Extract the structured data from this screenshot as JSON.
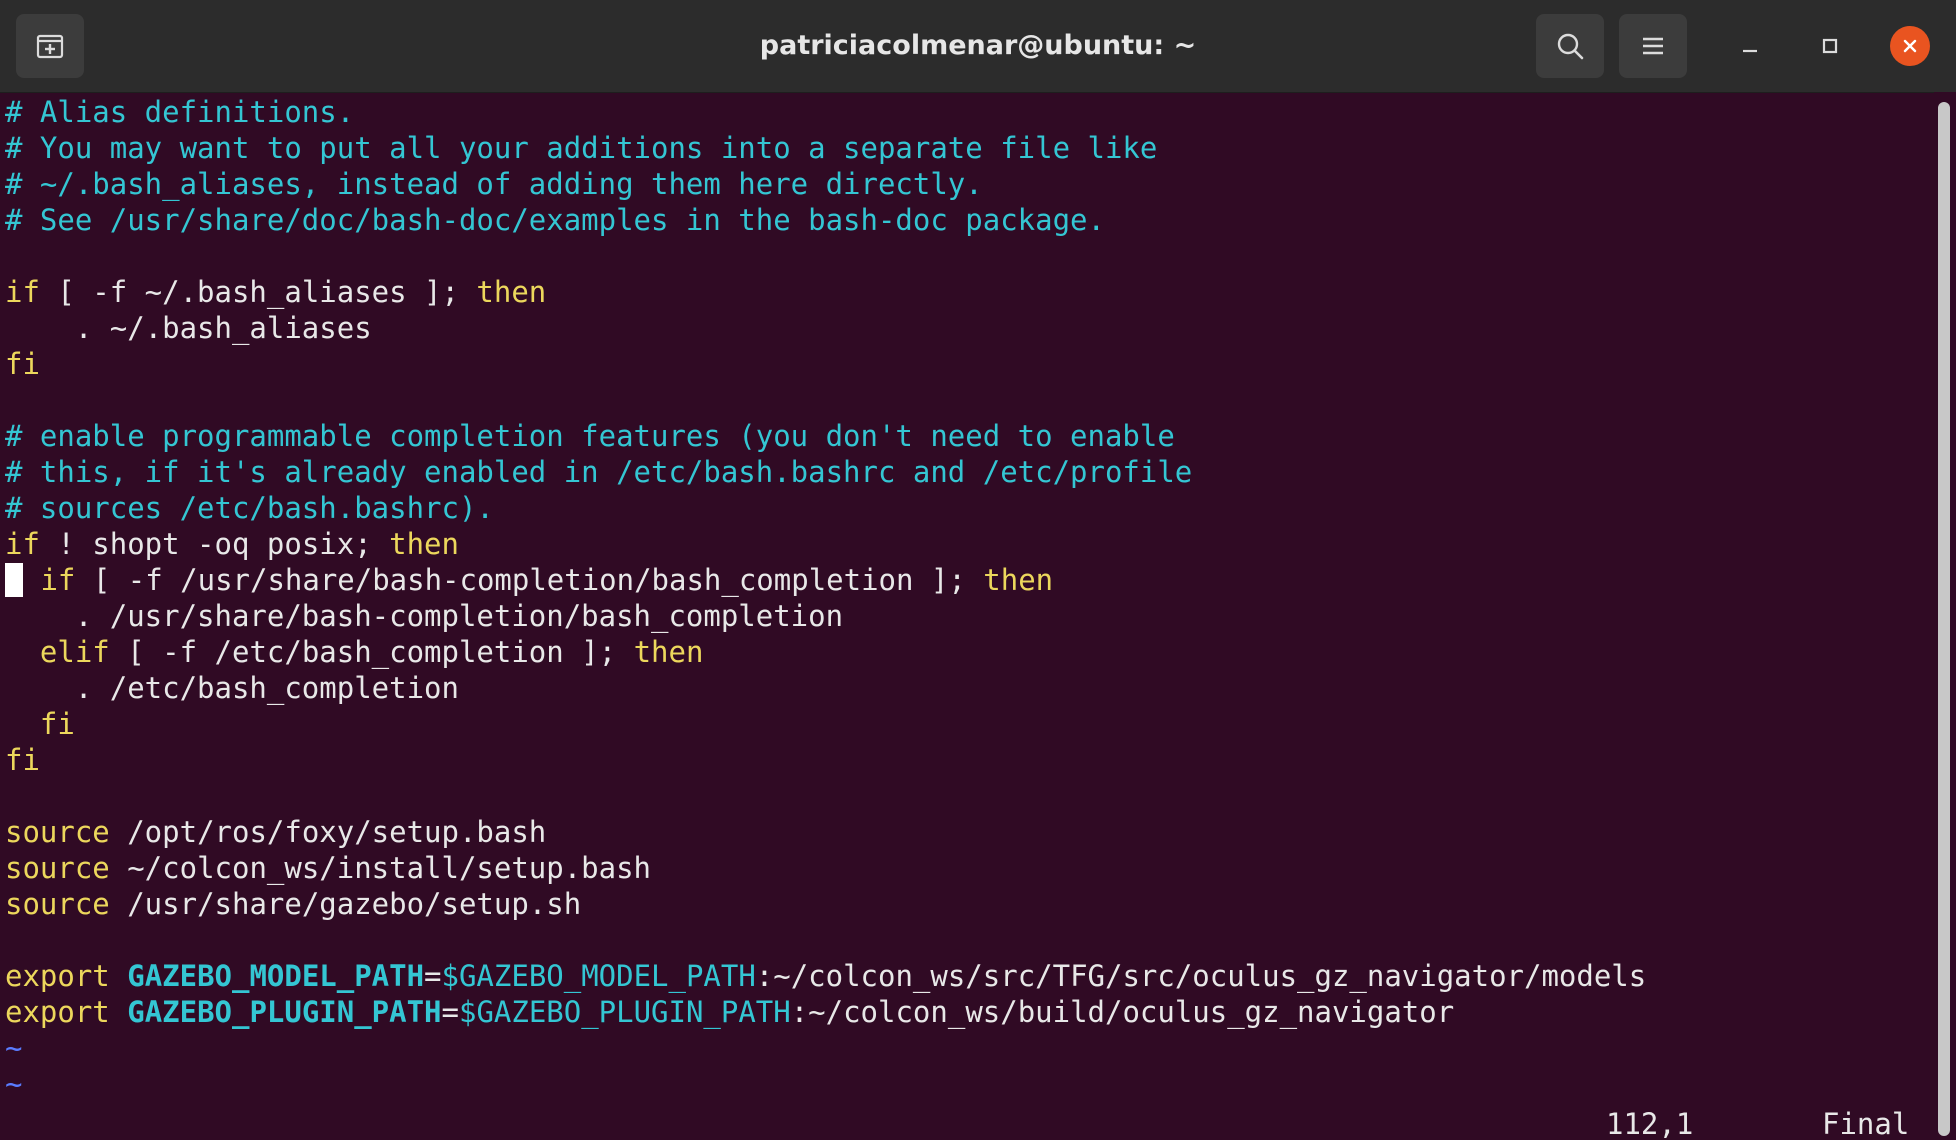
{
  "window": {
    "title": "patriciacolmenar@ubuntu: ~",
    "accent_color": "#e95420",
    "background_color": "#300a24",
    "icons": {
      "new_tab": "new-tab-icon",
      "search": "search-icon",
      "menu": "hamburger-menu-icon",
      "minimize": "minimize-icon",
      "maximize": "maximize-icon",
      "close": "close-icon"
    }
  },
  "editor": {
    "line1": {
      "comment": "# Alias definitions."
    },
    "line2": {
      "comment": "# You may want to put all your additions into a separate file like"
    },
    "line3": {
      "comment": "# ~/.bash_aliases, instead of adding them here directly."
    },
    "line4": {
      "comment": "# See /usr/share/doc/bash-doc/examples in the bash-doc package."
    },
    "line6": {
      "kw1": "if",
      "text": " [ -f ~/.bash_aliases ]; ",
      "kw2": "then"
    },
    "line7": {
      "text": "    . ~/.bash_aliases"
    },
    "line8": {
      "kw": "fi"
    },
    "line10": {
      "comment": "# enable programmable completion features (you don't need to enable"
    },
    "line11": {
      "comment": "# this, if it's already enabled in /etc/bash.bashrc and /etc/profile"
    },
    "line12": {
      "comment": "# sources /etc/bash.bashrc)."
    },
    "line13": {
      "kw1": "if",
      "text": " ! shopt -oq posix; ",
      "kw2": "then"
    },
    "line14": {
      "indent": " ",
      "kw1": "if",
      "text": " [ -f /usr/share/bash-completion/bash_completion ]; ",
      "kw2": "then"
    },
    "line15": {
      "text": "    . /usr/share/bash-completion/bash_completion"
    },
    "line16": {
      "indent": "  ",
      "kw1": "elif",
      "text": " [ -f /etc/bash_completion ]; ",
      "kw2": "then"
    },
    "line17": {
      "text": "    . /etc/bash_completion"
    },
    "line18": {
      "indent": "  ",
      "kw": "fi"
    },
    "line19": {
      "kw": "fi"
    },
    "line21": {
      "kw": "source",
      "text": " /opt/ros/foxy/setup.bash"
    },
    "line22": {
      "kw": "source",
      "text": " ~/colcon_ws/install/setup.bash"
    },
    "line23": {
      "kw": "source",
      "text": " /usr/share/gazebo/setup.sh"
    },
    "line25": {
      "kw": "export",
      "sp": " ",
      "var": "GAZEBO_MODEL_PATH",
      "eq": "=",
      "ref": "$GAZEBO_MODEL_PATH",
      "rest": ":~/colcon_ws/src/TFG/src/oculus_gz_navigator/models"
    },
    "line26": {
      "kw": "export",
      "sp": " ",
      "var": "GAZEBO_PLUGIN_PATH",
      "eq": "=",
      "ref": "$GAZEBO_PLUGIN_PATH",
      "rest": ":~/colcon_ws/build/oculus_gz_navigator"
    },
    "tilde1": "~",
    "tilde2": "~"
  },
  "status": {
    "position": "112,1",
    "mode": "Final"
  }
}
